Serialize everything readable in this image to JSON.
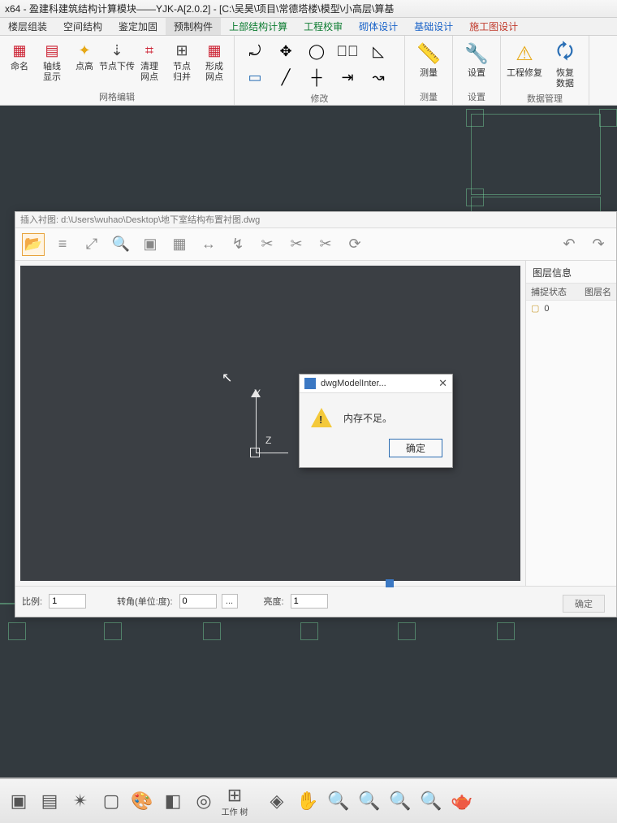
{
  "titlebar": "x64 - 盈建科建筑结构计算模块——YJK-A[2.0.2] - [C:\\吴昊\\项目\\常德塔楼\\模型\\小高层\\算基",
  "menu": {
    "items": [
      "楼层组装",
      "空间结构",
      "鉴定加固",
      "预制构件",
      "上部结构计算",
      "工程校审",
      "砌体设计",
      "基础设计",
      "施工图设计"
    ]
  },
  "ribbon": {
    "group_grid": {
      "name": "网格编辑",
      "btns": [
        "命名",
        "轴线\n显示",
        "点高",
        "节点下传",
        "清理\n网点",
        "节点\n归并",
        "形成\n网点"
      ]
    },
    "group_modify": {
      "name": "修改"
    },
    "group_measure": {
      "name": "测量",
      "btn": "测量"
    },
    "group_set": {
      "name": "设置",
      "btn": "设置"
    },
    "group_data": {
      "name": "数据管理",
      "btns": [
        "工程修复",
        "恢复\n数据"
      ]
    }
  },
  "insert": {
    "title": "插入衬图:  d:\\Users\\wuhao\\Desktop\\地下室结构布置衬图.dwg",
    "side_header": "图层信息",
    "col1": "捕捉状态",
    "col2": "图层名",
    "row_val": "0",
    "ratio_label": "比例:",
    "ratio_val": "1",
    "angle_label": "转角(单位:度):",
    "angle_val": "0",
    "bright_label": "亮度:",
    "bright_val": "1",
    "ok": "确定",
    "axis_y": "Y",
    "axis_z": "Z"
  },
  "modal": {
    "title": "dwgModelInter...",
    "msg": "内存不足。",
    "ok": "确定"
  },
  "bottom": {
    "worktree": "工作\n树"
  }
}
